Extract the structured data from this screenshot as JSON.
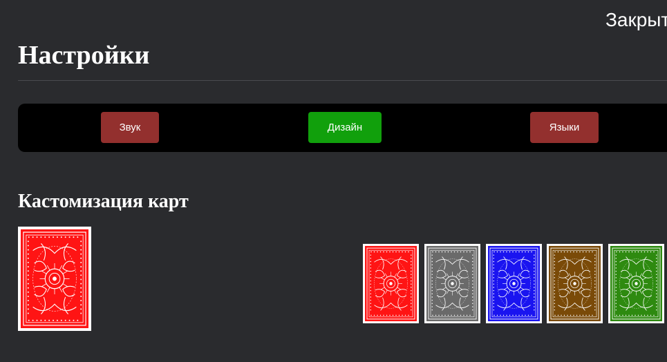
{
  "header": {
    "close_label": "Закрыть",
    "title": "Настройки"
  },
  "tabs": [
    {
      "label": "Звук",
      "color": "#93302e",
      "active": false
    },
    {
      "label": "Дизайн",
      "color": "#11a00c",
      "active": true
    },
    {
      "label": "Языки",
      "color": "#93302e",
      "active": false
    }
  ],
  "card_customization": {
    "title": "Кастомизация карт",
    "selected_color": "#ff1414",
    "options": [
      {
        "name": "red",
        "color": "#ff1414"
      },
      {
        "name": "gray",
        "color": "#6a6a6a"
      },
      {
        "name": "blue",
        "color": "#1a14f0"
      },
      {
        "name": "brown",
        "color": "#7a4a08"
      },
      {
        "name": "green",
        "color": "#2e8a10"
      }
    ]
  }
}
